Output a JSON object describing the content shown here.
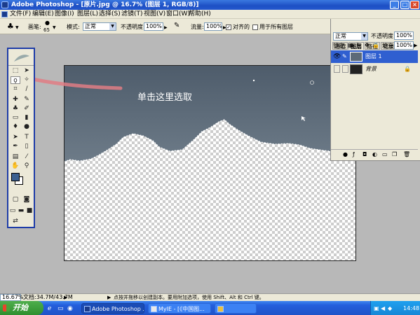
{
  "window": {
    "title": "Adobe Photoshop - [原片.jpg @ 16.7% (图层 1, RGB/8)]",
    "buttons": [
      "_",
      "□",
      "×"
    ]
  },
  "menu": {
    "items": [
      "文件(F)",
      "编辑(E)",
      "图像(I)",
      "图层(L)",
      "选择(S)",
      "滤镜(T)",
      "视图(V)",
      "窗口(W)",
      "帮助(H)"
    ]
  },
  "options": {
    "brush_label": "画笔:",
    "brush_size": "65",
    "mode_label": "模式:",
    "mode_value": "正常",
    "opacity_label": "不透明度:",
    "opacity_value": "100%",
    "flow_label": "流量:",
    "flow_value": "100%",
    "aligned_label": "对齐的",
    "all_layers_label": "用于所有图层"
  },
  "panel": {
    "tabs": [
      "通道",
      "图层",
      "路径",
      "记录",
      "动作"
    ],
    "blend_mode": "正常",
    "opacity_label": "不透明度:",
    "opacity_value": "100%",
    "lock_label": "锁定:",
    "fill_label": "填充:",
    "fill_value": "100%",
    "layers": [
      {
        "name": "图层 1",
        "selected": true
      },
      {
        "name": "背景",
        "selected": false,
        "locked": true
      }
    ]
  },
  "canvas": {
    "hint": "单击这里选取"
  },
  "status": {
    "zoom": "16.67%",
    "doc": "文档:34.7M/43.7M",
    "tip": "点按并拖移以创建副本。要用附加选项，使用 Shift、Alt 和 Ctrl 键。"
  },
  "taskbar": {
    "start": "开始",
    "tasks": [
      "Adobe Photoshop ...",
      "MyIE - [《中国图...",
      ""
    ],
    "clock": "14:48"
  },
  "colors": {
    "foreground": "#3b5f8f",
    "background": "#ffffff",
    "sky": "#5c6a78",
    "selection_highlight": "#2f5fd0"
  }
}
